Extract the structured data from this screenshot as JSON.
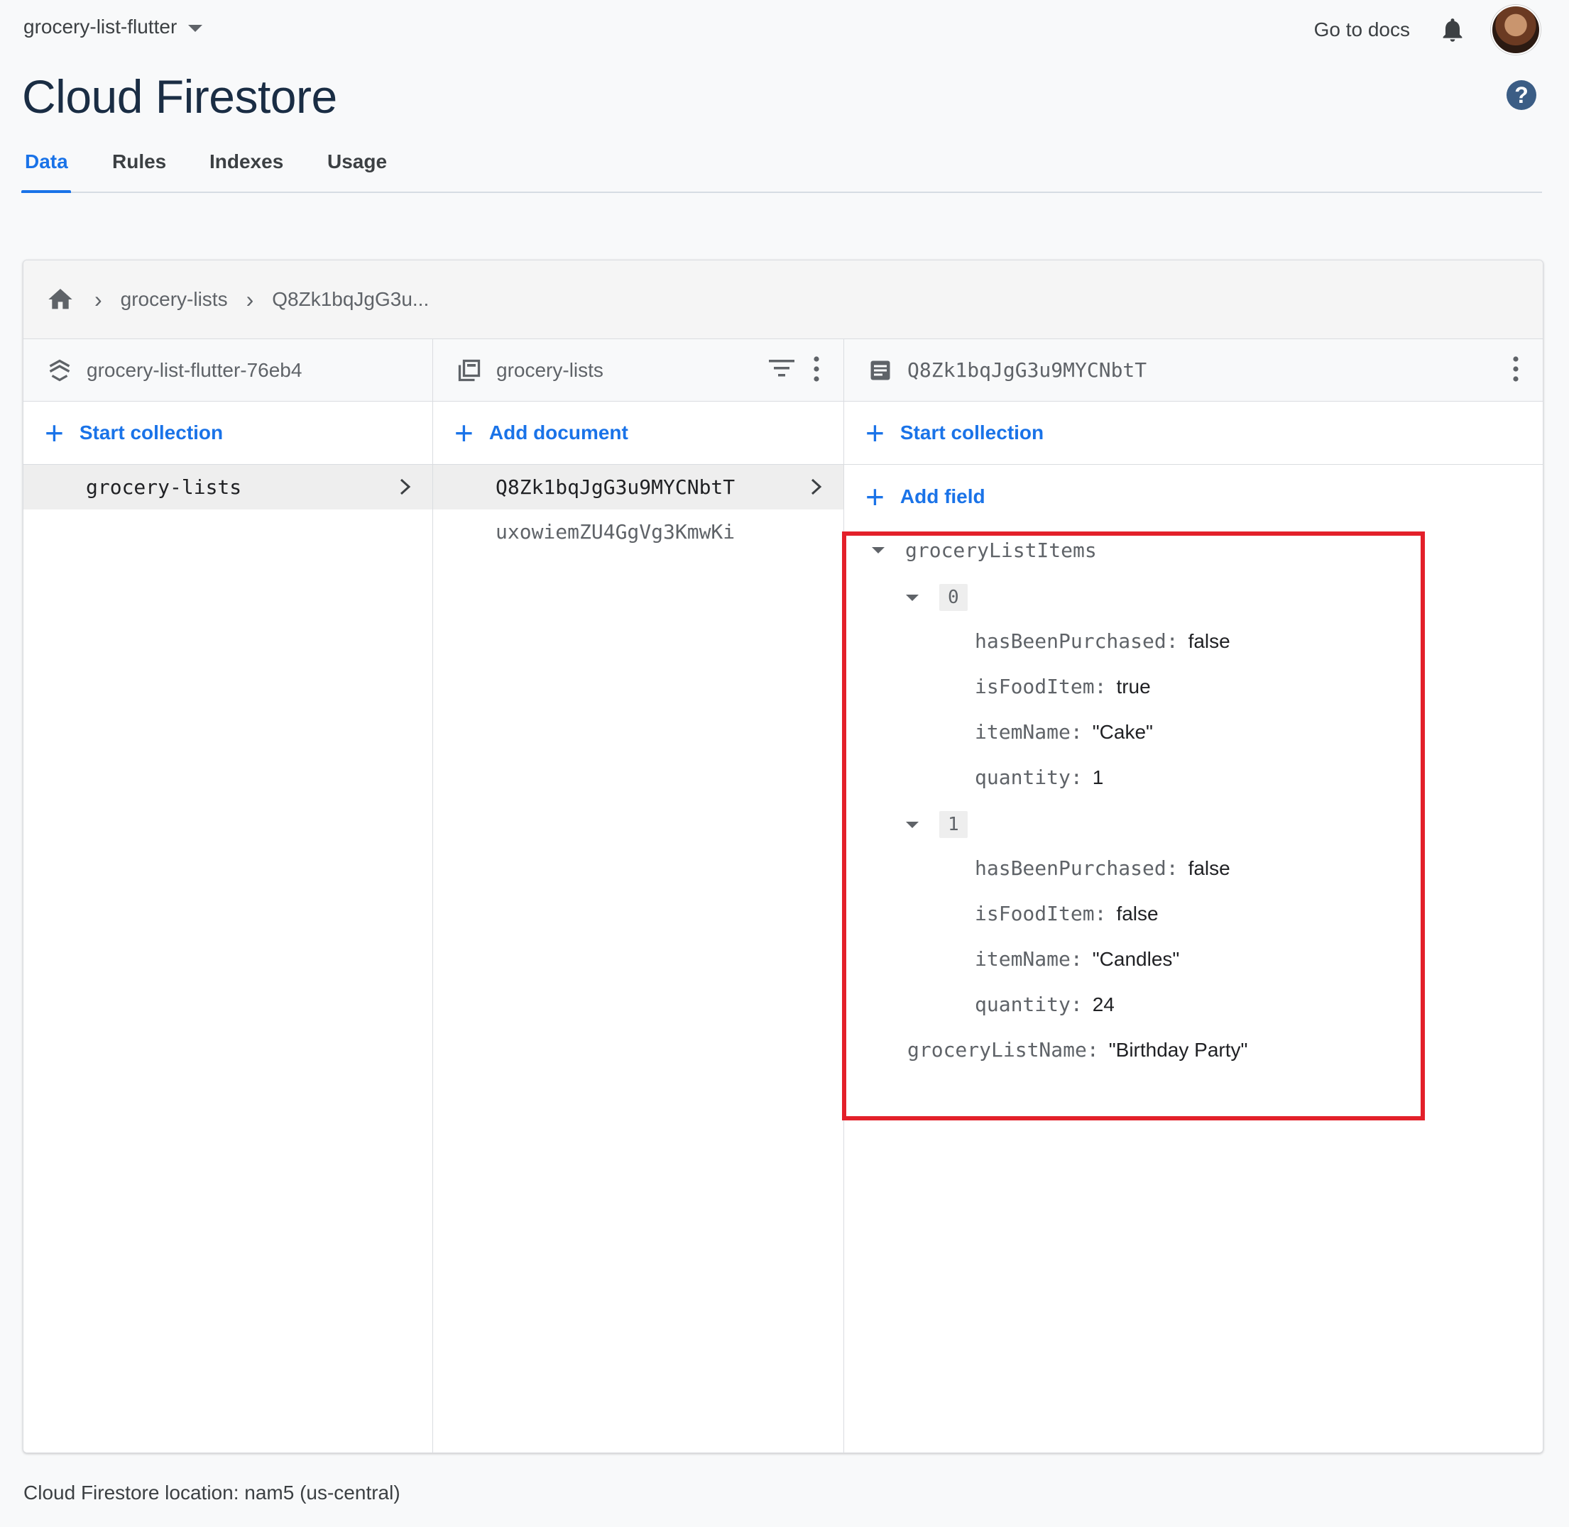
{
  "top": {
    "project_name": "grocery-list-flutter",
    "docs_link": "Go to docs"
  },
  "page": {
    "title": "Cloud Firestore"
  },
  "tabs": [
    {
      "label": "Data",
      "active": true
    },
    {
      "label": "Rules",
      "active": false
    },
    {
      "label": "Indexes",
      "active": false
    },
    {
      "label": "Usage",
      "active": false
    }
  ],
  "breadcrumb": {
    "items": [
      "grocery-lists",
      "Q8Zk1bqJgG3u..."
    ]
  },
  "columns": {
    "root": {
      "title": "grocery-list-flutter-76eb4",
      "action": "Start collection",
      "items": [
        {
          "label": "grocery-lists",
          "selected": true
        }
      ]
    },
    "collection": {
      "title": "grocery-lists",
      "action": "Add document",
      "items": [
        {
          "label": "Q8Zk1bqJgG3u9MYCNbtT",
          "selected": true
        },
        {
          "label": "uxowiemZU4GgVg3KmwKi",
          "selected": false
        }
      ]
    },
    "document": {
      "title": "Q8Zk1bqJgG3u9MYCNbtT",
      "action_collection": "Start collection",
      "action_field": "Add field",
      "fields": {
        "list_key": "groceryListItems",
        "items": [
          {
            "index": "0",
            "hasBeenPurchased": "false",
            "isFoodItem": "true",
            "itemName": "\"Cake\"",
            "quantity": "1"
          },
          {
            "index": "1",
            "hasBeenPurchased": "false",
            "isFoodItem": "false",
            "itemName": "\"Candles\"",
            "quantity": "24"
          }
        ],
        "keys": {
          "hasBeenPurchased": "hasBeenPurchased:",
          "isFoodItem": "isFoodItem:",
          "itemName": "itemName:",
          "quantity": "quantity:"
        },
        "name_key": "groceryListName:",
        "name_value": "\"Birthday Party\""
      }
    }
  },
  "footer": {
    "location": "Cloud Firestore location: nam5 (us-central)"
  },
  "colors": {
    "accent": "#1a73e8",
    "highlight": "#e3202a",
    "title": "#1a2d44"
  }
}
